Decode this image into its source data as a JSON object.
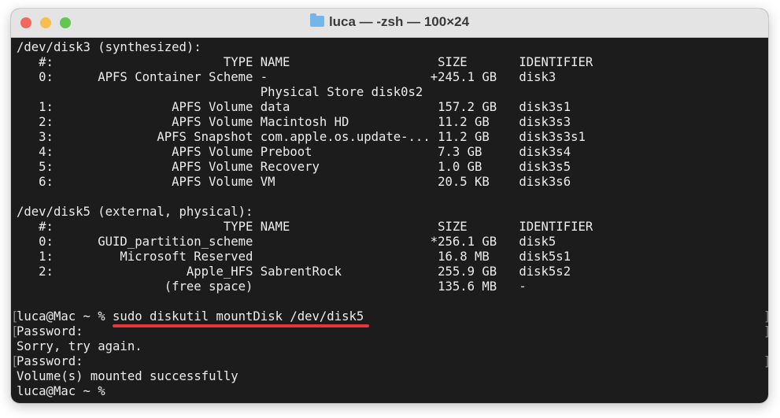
{
  "window": {
    "title": "luca — -zsh — 100×24"
  },
  "colors": {
    "underline": "#e8343a",
    "background": "#1c1c1c"
  },
  "headers": {
    "index": "#:",
    "type": "TYPE",
    "name": "NAME",
    "size": "SIZE",
    "identifier": "IDENTIFIER"
  },
  "disks": [
    {
      "title": "/dev/disk3 (synthesized):",
      "rows": [
        {
          "index": "0:",
          "type": "APFS Container Scheme",
          "name": "-",
          "size": "+245.1 GB",
          "identifier": "disk3"
        },
        {
          "index": "",
          "type": "",
          "name": "Physical Store disk0s2",
          "size": "",
          "identifier": ""
        },
        {
          "index": "1:",
          "type": "APFS Volume",
          "name": "data",
          "size": "157.2 GB",
          "identifier": "disk3s1"
        },
        {
          "index": "2:",
          "type": "APFS Volume",
          "name": "Macintosh HD",
          "size": "11.2 GB",
          "identifier": "disk3s3"
        },
        {
          "index": "3:",
          "type": "APFS Snapshot",
          "name": "com.apple.os.update-...",
          "size": "11.2 GB",
          "identifier": "disk3s3s1"
        },
        {
          "index": "4:",
          "type": "APFS Volume",
          "name": "Preboot",
          "size": "7.3 GB",
          "identifier": "disk3s4"
        },
        {
          "index": "5:",
          "type": "APFS Volume",
          "name": "Recovery",
          "size": "1.0 GB",
          "identifier": "disk3s5"
        },
        {
          "index": "6:",
          "type": "APFS Volume",
          "name": "VM",
          "size": "20.5 KB",
          "identifier": "disk3s6"
        }
      ]
    },
    {
      "title": "/dev/disk5 (external, physical):",
      "rows": [
        {
          "index": "0:",
          "type": "GUID_partition_scheme",
          "name": "",
          "size": "*256.1 GB",
          "identifier": "disk5"
        },
        {
          "index": "1:",
          "type": "Microsoft Reserved",
          "name": "",
          "size": "16.8 MB",
          "identifier": "disk5s1"
        },
        {
          "index": "2:",
          "type": "Apple_HFS",
          "name": "SabrentRock",
          "size": "255.9 GB",
          "identifier": "disk5s2"
        },
        {
          "index": "",
          "type": "(free space)",
          "name": "",
          "size": "135.6 MB",
          "identifier": "-"
        }
      ]
    }
  ],
  "session": [
    {
      "text": "luca@Mac ~ % sudo diskutil mountDisk /dev/disk5",
      "marked": true
    },
    {
      "text": "Password:",
      "marked": true
    },
    {
      "text": "Sorry, try again.",
      "marked": false
    },
    {
      "text": "Password:",
      "marked": true
    },
    {
      "text": "Volume(s) mounted successfully",
      "marked": false
    },
    {
      "text": "luca@Mac ~ %",
      "marked": false
    }
  ]
}
